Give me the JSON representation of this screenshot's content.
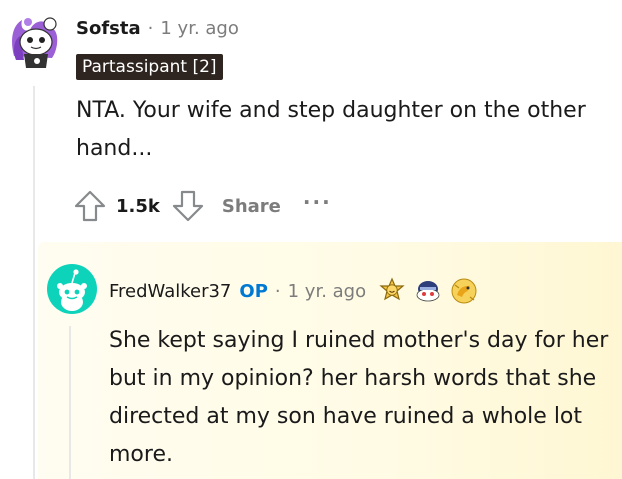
{
  "comment": {
    "username": "Sofsta",
    "separator": "·",
    "time": "1 yr. ago",
    "flair": "Partassipant [2]",
    "body": "NTA. Your wife and step daughter on the other hand...",
    "score": "1.5k",
    "share_label": "Share",
    "more_label": "···"
  },
  "reply": {
    "username": "FredWalker37",
    "op_badge": "OP",
    "separator": "·",
    "time": "1 yr. ago",
    "awards": [
      "wholesome-award-icon",
      "helmet-award-icon",
      "dragon-award-icon"
    ],
    "body": "She kept saying I ruined mother's day for her but in my opinion? her harsh words that she directed at my son have ruined a whole lot more."
  },
  "colors": {
    "op_blue": "#0079d3",
    "muted": "#7c7c7c",
    "flair_bg": "#2e2520",
    "highlight_bg": "#fffbe4"
  }
}
